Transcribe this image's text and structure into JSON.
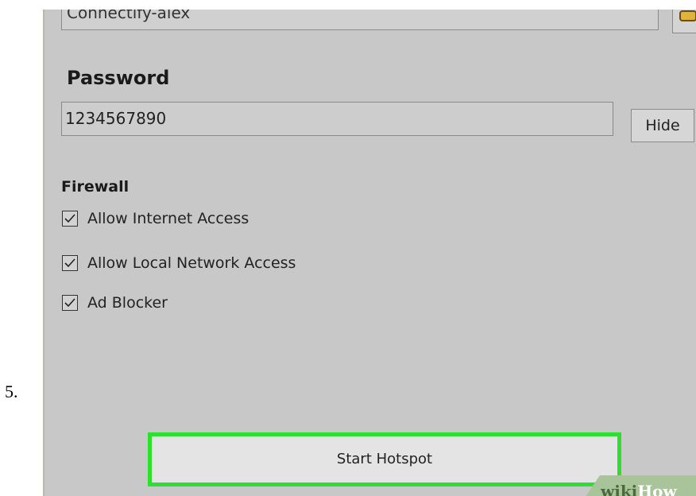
{
  "step": {
    "number": "5."
  },
  "form": {
    "ssid_value": "Connectify-alex",
    "password_label": "Password",
    "password_value": "1234567890",
    "hide_button_label": "Hide",
    "firewall_label": "Firewall",
    "firewall_options": [
      {
        "label": "Allow Internet Access",
        "checked": true
      },
      {
        "label": "Allow Local Network Access",
        "checked": true
      },
      {
        "label": "Ad Blocker",
        "checked": true
      }
    ],
    "start_button_label": "Start Hotspot",
    "start_button_highlight_color": "#2ee02e"
  },
  "watermark": {
    "part1": "wiki",
    "part2": "How"
  },
  "icons": {
    "ssid_button": "edit-icon",
    "checkbox": "checkmark-icon"
  }
}
